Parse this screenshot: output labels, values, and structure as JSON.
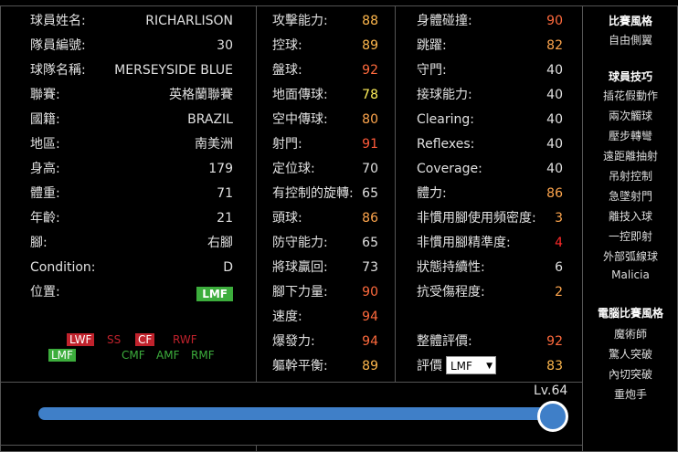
{
  "info": [
    {
      "label": "球員姓名:",
      "value": "RICHARLISON"
    },
    {
      "label": "隊員編號:",
      "value": "30"
    },
    {
      "label": "球隊名稱:",
      "value": "MERSEYSIDE BLUE"
    },
    {
      "label": "聯賽:",
      "value": "英格蘭聯賽"
    },
    {
      "label": "國籍:",
      "value": "BRAZIL"
    },
    {
      "label": "地區:",
      "value": "南美洲"
    },
    {
      "label": "身高:",
      "value": "179"
    },
    {
      "label": "體重:",
      "value": "71"
    },
    {
      "label": "年齡:",
      "value": "21"
    },
    {
      "label": "腳:",
      "value": "右腳"
    },
    {
      "label": "Condition:",
      "value": "D"
    },
    {
      "label": "位置:",
      "value": "LMF"
    }
  ],
  "positions": {
    "row1": [
      "LWF",
      "SS",
      "CF",
      "RWF"
    ],
    "row2": [
      "LMF",
      "CMF",
      "AMF",
      "RMF"
    ]
  },
  "stats_col1": [
    {
      "label": "攻擊能力:",
      "value": "88",
      "color": "#ffb84d"
    },
    {
      "label": "控球:",
      "value": "89",
      "color": "#ffb84d"
    },
    {
      "label": "盤球:",
      "value": "92",
      "color": "#ff6a3d"
    },
    {
      "label": "地面傳球:",
      "value": "78",
      "color": "#ffef5a"
    },
    {
      "label": "空中傳球:",
      "value": "80",
      "color": "#ffa64d"
    },
    {
      "label": "射門:",
      "value": "91",
      "color": "#ff5a3a"
    },
    {
      "label": "定位球:",
      "value": "70",
      "color": "#e0e0e0"
    },
    {
      "label": "有控制的旋轉:",
      "value": "65",
      "color": "#e0e0e0"
    },
    {
      "label": "頭球:",
      "value": "86",
      "color": "#ffa64d"
    },
    {
      "label": "防守能力:",
      "value": "65",
      "color": "#e0e0e0"
    },
    {
      "label": "將球贏回:",
      "value": "73",
      "color": "#e0e0e0"
    },
    {
      "label": "腳下力量:",
      "value": "90",
      "color": "#ff6a3d"
    },
    {
      "label": "速度:",
      "value": "94",
      "color": "#ff6a3d"
    },
    {
      "label": "爆發力:",
      "value": "94",
      "color": "#ff6a3d"
    },
    {
      "label": "軀幹平衡:",
      "value": "89",
      "color": "#ffb84d"
    }
  ],
  "stats_col2": [
    {
      "label": "身體碰撞:",
      "value": "90",
      "color": "#ff6a3d"
    },
    {
      "label": "跳躍:",
      "value": "82",
      "color": "#ffa64d"
    },
    {
      "label": "守門:",
      "value": "40",
      "color": "#e0e0e0"
    },
    {
      "label": "接球能力:",
      "value": "40",
      "color": "#e0e0e0"
    },
    {
      "label": "Clearing:",
      "value": "40",
      "color": "#e0e0e0"
    },
    {
      "label": "Reflexes:",
      "value": "40",
      "color": "#e0e0e0"
    },
    {
      "label": "Coverage:",
      "value": "40",
      "color": "#e0e0e0"
    },
    {
      "label": "體力:",
      "value": "86",
      "color": "#ffa64d"
    },
    {
      "label": "非慣用腳使用頻密度:",
      "value": "3",
      "color": "#ffa64d"
    },
    {
      "label": "非慣用腳精準度:",
      "value": "4",
      "color": "#ff2a2a"
    },
    {
      "label": "狀態持續性:",
      "value": "6",
      "color": "#e0e0e0"
    },
    {
      "label": "抗受傷程度:",
      "value": "2",
      "color": "#ffa64d"
    }
  ],
  "overall": {
    "label": "整體評價:",
    "value": "92",
    "color": "#ff6a3d"
  },
  "rating": {
    "label": "評價",
    "select": "LMF",
    "value": "83",
    "color": "#ffb84d"
  },
  "sidebar": {
    "style_title": "比賽風格",
    "style_items": [
      "自由側翼"
    ],
    "skills_title": "球員技巧",
    "skills_items": [
      "插花假動作",
      "兩次觸球",
      "壓步轉彎",
      "遠距離抽射",
      "吊射控制",
      "急墜射門",
      "離技入球",
      "一控即射",
      "外部弧線球",
      "Malicia"
    ],
    "ai_title": "電腦比賽風格",
    "ai_items": [
      "魔術師",
      "驚人突破",
      "內切突破",
      "重炮手"
    ]
  },
  "level": {
    "label": "Lv.64",
    "value": 64
  }
}
